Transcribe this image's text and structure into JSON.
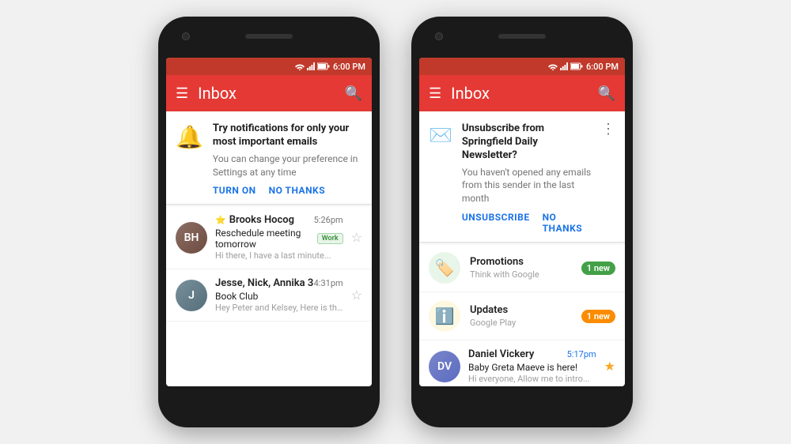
{
  "bg_color": "#f1f1f1",
  "phone1": {
    "status_bar": {
      "time": "6:00 PM"
    },
    "toolbar": {
      "title": "Inbox"
    },
    "banner": {
      "icon": "🔔",
      "title": "Try notifications for only your most important emails",
      "subtitle": "You can change your preference in Settings at any time",
      "btn_primary": "TURN ON",
      "btn_secondary": "NO THANKS"
    },
    "emails": [
      {
        "sender": "Brooks Hocog",
        "sender_prefix": "⭐",
        "time": "5:26pm",
        "subject": "Reschedule meeting tomorrow",
        "preview": "Hi there, I have a last minute...",
        "badge": "Work",
        "avatar_initials": "BH",
        "starred": false
      },
      {
        "sender": "Jesse, Nick, Annika 3",
        "time": "4:31pm",
        "subject": "Book Club",
        "preview": "Hey Peter and Kelsey, Here is the list...",
        "badge": "",
        "avatar_initials": "J",
        "starred": false
      }
    ]
  },
  "phone2": {
    "status_bar": {
      "time": "6:00 PM"
    },
    "toolbar": {
      "title": "Inbox"
    },
    "banner": {
      "title": "Unsubscribe from Springfield Daily Newsletter?",
      "subtitle": "You haven't opened any emails from this sender in the last month",
      "btn_primary": "UNSUBSCRIBE",
      "btn_secondary": "NO THANKS"
    },
    "categories": [
      {
        "name": "Promotions",
        "sub": "Think with Google",
        "badge": "1 new",
        "badge_color": "green",
        "icon": "🏷️",
        "icon_color": "green"
      },
      {
        "name": "Updates",
        "sub": "Google Play",
        "badge": "1 new",
        "badge_color": "orange",
        "icon": "ℹ️",
        "icon_color": "orange"
      }
    ],
    "email": {
      "sender": "Daniel Vickery",
      "time": "5:17pm",
      "subject": "Baby Greta Maeve is here!",
      "preview": "Hi everyone, Allow me to intro...",
      "avatar_initials": "DV",
      "starred": true
    }
  }
}
